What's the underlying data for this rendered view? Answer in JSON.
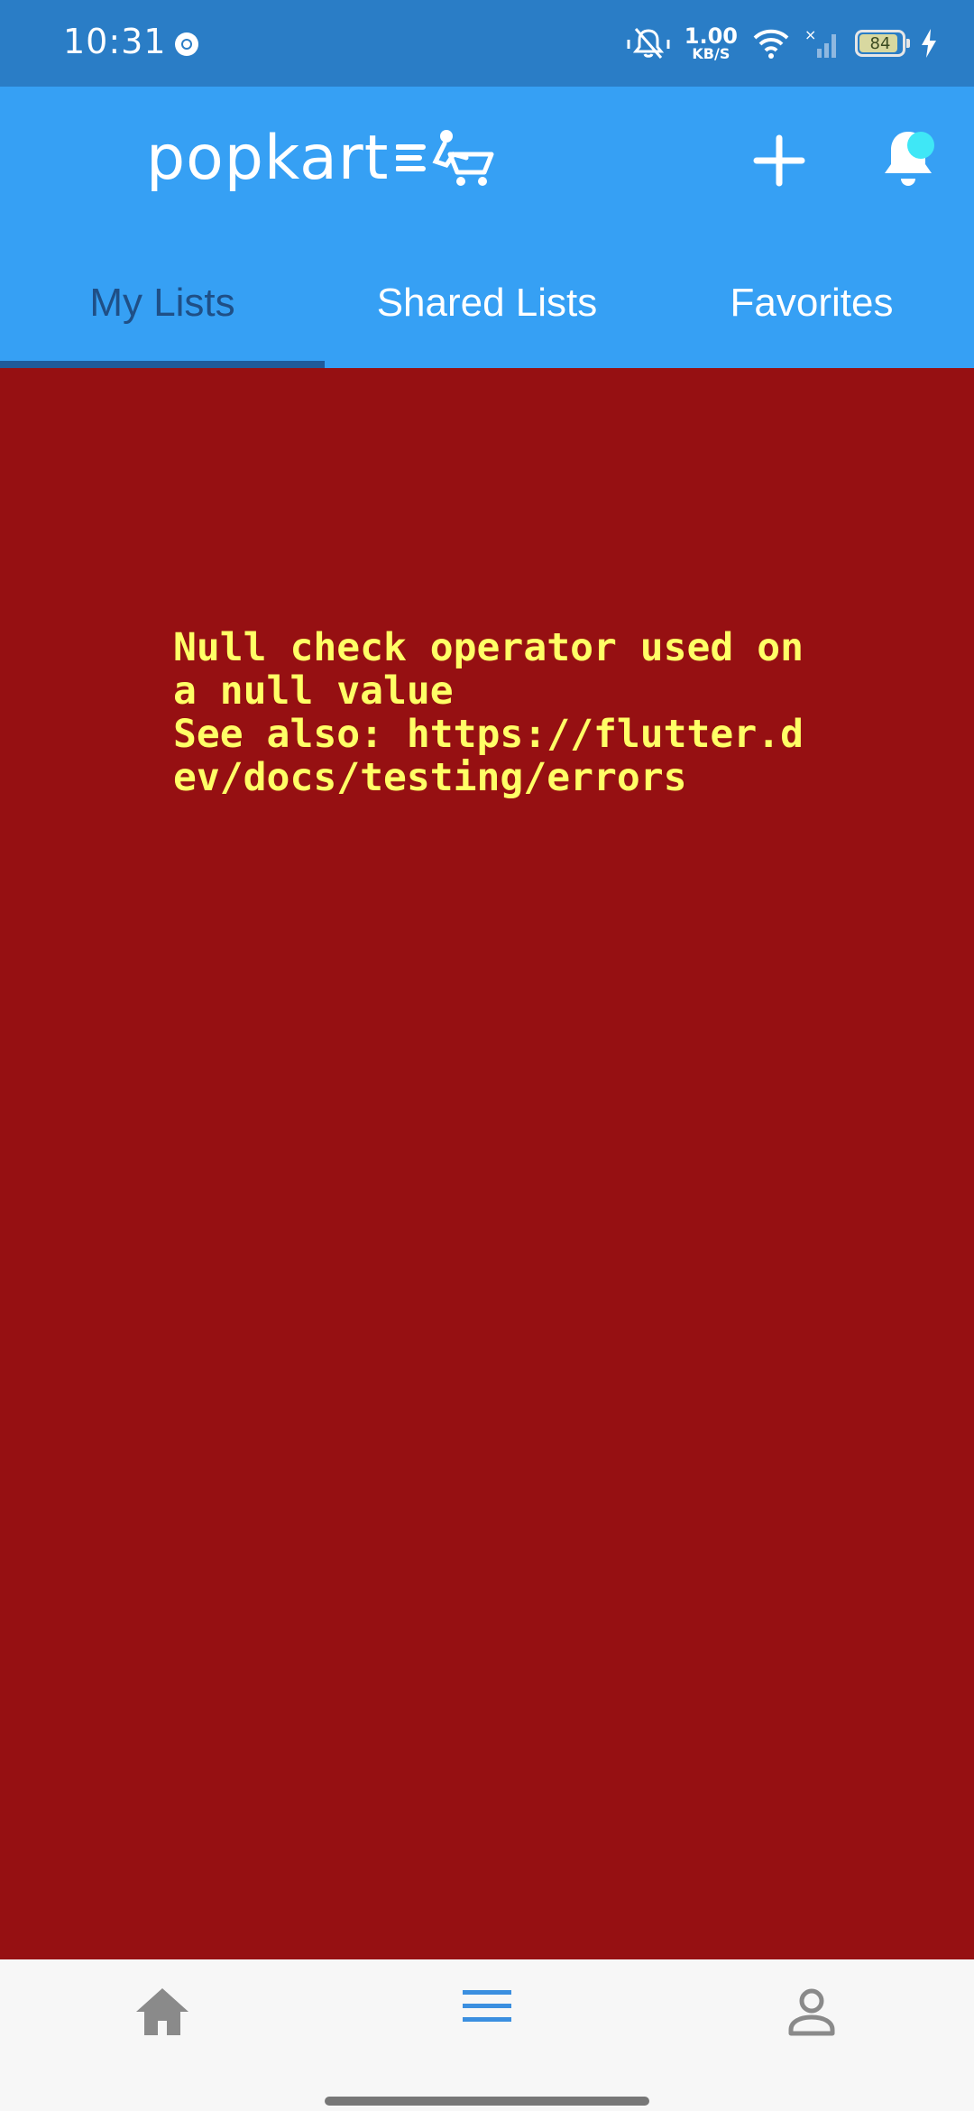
{
  "status_bar": {
    "time": "10:31",
    "net_speed_value": "1.00",
    "net_speed_unit": "KB/S",
    "battery_level": "84",
    "icons": [
      "chrome-icon",
      "vibrate-bell-off-icon",
      "wifi-icon",
      "signal-icon",
      "battery-icon",
      "charging-bolt-icon"
    ]
  },
  "app_bar": {
    "logo_text": "popkart",
    "background": "#36a0f4",
    "icons": [
      "add-icon",
      "bell-icon"
    ],
    "notification_dot_color": "#3fe7f6"
  },
  "tabs": [
    {
      "label": "My Lists",
      "active": true
    },
    {
      "label": "Shared Lists",
      "active": false
    },
    {
      "label": "Favorites",
      "active": false
    }
  ],
  "error": {
    "message": "Null check operator used on a null value\nSee also: https://flutter.dev/docs/testing/errors",
    "background": "#961012",
    "text_color": "#ffff66"
  },
  "bottom_nav": {
    "items": [
      {
        "icon": "home-icon",
        "active": false
      },
      {
        "icon": "menu-lines-icon",
        "active": true
      },
      {
        "icon": "profile-icon",
        "active": false
      }
    ],
    "active_color": "#3b8fe0",
    "inactive_color": "#8a8a8a"
  }
}
